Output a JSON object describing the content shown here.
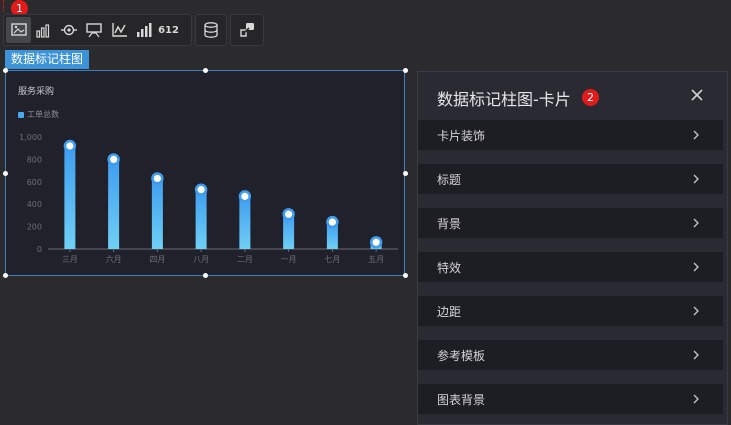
{
  "callouts": {
    "toolbar": "1",
    "panel": "2"
  },
  "toolbar": {
    "buttons": [
      {
        "id": "image",
        "icon": "image-icon",
        "active": true
      },
      {
        "id": "bar",
        "icon": "bar-chart-icon"
      },
      {
        "id": "target",
        "icon": "target-icon"
      },
      {
        "id": "card",
        "icon": "card-icon"
      },
      {
        "id": "line",
        "icon": "line-chart-icon"
      },
      {
        "id": "step",
        "icon": "step-bar-icon"
      },
      {
        "id": "number",
        "icon": "number-icon",
        "label": "612"
      }
    ],
    "database_icon": "database-icon",
    "link_icon": "link-icon"
  },
  "component_tag": "数据标记柱图",
  "chart_data": {
    "type": "bar",
    "title": "服务采购",
    "legend": [
      "工单总数"
    ],
    "categories": [
      "三月",
      "六月",
      "四月",
      "八月",
      "二月",
      "一月",
      "七月",
      "五月"
    ],
    "values": [
      920,
      800,
      630,
      530,
      470,
      310,
      240,
      60
    ],
    "ylim": [
      0,
      1000
    ],
    "yticks": [
      "0",
      "200",
      "400",
      "600",
      "800",
      "1,000"
    ],
    "bar_color_top": "#3f9df0",
    "bar_color_bottom": "#6fd0f5"
  },
  "panel": {
    "title": "数据标记柱图-卡片",
    "rows": [
      "卡片装饰",
      "标题",
      "背景",
      "特效",
      "边距",
      "参考模板",
      "图表背景"
    ]
  }
}
